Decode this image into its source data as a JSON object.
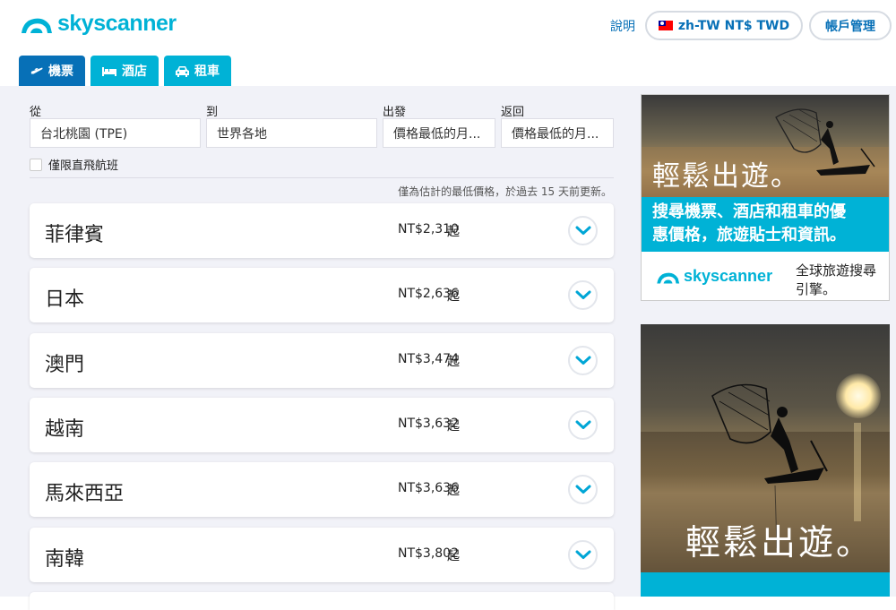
{
  "brand": {
    "name": "skyscanner",
    "color": "#00b2d6"
  },
  "header": {
    "help": "說明",
    "locale": "zh-TW NT$ TWD",
    "account": "帳戶管理"
  },
  "tabs": [
    {
      "label": "機票",
      "icon": "plane-icon",
      "active": true
    },
    {
      "label": "酒店",
      "icon": "bed-icon",
      "active": false
    },
    {
      "label": "租車",
      "icon": "car-icon",
      "active": false
    }
  ],
  "search": {
    "from_label": "從",
    "from_value": "台北桃園 (TPE)",
    "to_label": "到",
    "to_value": "世界各地",
    "depart_label": "出發",
    "depart_value": "價格最低的月...",
    "return_label": "返回",
    "return_value": "價格最低的月...",
    "direct_label": "僅限直飛航班",
    "note": "僅為估計的最低價格，於過去 15 天前更新。"
  },
  "results": [
    {
      "country": "菲律賓",
      "price": "NT$2,310",
      "suffix": "起"
    },
    {
      "country": "日本",
      "price": "NT$2,636",
      "suffix": "起"
    },
    {
      "country": "澳門",
      "price": "NT$3,474",
      "suffix": "起"
    },
    {
      "country": "越南",
      "price": "NT$3,632",
      "suffix": "起"
    },
    {
      "country": "馬來西亞",
      "price": "NT$3,636",
      "suffix": "起"
    },
    {
      "country": "南韓",
      "price": "NT$3,802",
      "suffix": "起"
    }
  ],
  "ads": {
    "ad1": {
      "headline": "輕鬆出遊。",
      "band_line1": "搜尋機票、酒店和租車的優",
      "band_line2": "惠價格，旅遊貼士和資訊。",
      "logo": "skyscanner",
      "tagline": "全球旅遊搜尋引擎。"
    },
    "ad2": {
      "headline": "輕鬆出遊。"
    }
  },
  "colors": {
    "accent": "#00b2d6",
    "active_tab": "#0770b7",
    "chevron": "#00a6d6"
  }
}
